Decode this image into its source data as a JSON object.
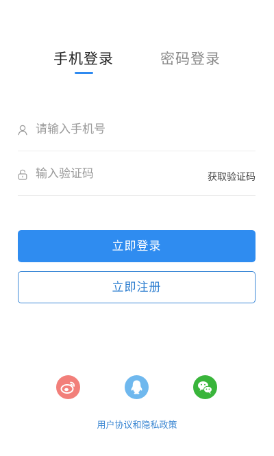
{
  "tabs": {
    "phone_login": "手机登录",
    "password_login": "密码登录",
    "active": "phone_login"
  },
  "form": {
    "phone": {
      "placeholder": "请输入手机号",
      "value": "",
      "icon": "user-icon"
    },
    "code": {
      "placeholder": "输入验证码",
      "value": "",
      "icon": "lock-icon",
      "get_code_label": "获取验证码"
    }
  },
  "buttons": {
    "login_label": "立即登录",
    "register_label": "立即注册"
  },
  "social": [
    {
      "name": "weibo",
      "icon": "weibo-icon",
      "color": "#f27f7a"
    },
    {
      "name": "qq",
      "icon": "qq-icon",
      "color": "#6fb8ee"
    },
    {
      "name": "wechat",
      "icon": "wechat-icon",
      "color": "#39b53b"
    }
  ],
  "footer": {
    "policy_link": "用户协议和隐私政策"
  },
  "colors": {
    "accent": "#2f8cf0",
    "indicator": "#2f8af0",
    "link": "#3a86d2"
  }
}
